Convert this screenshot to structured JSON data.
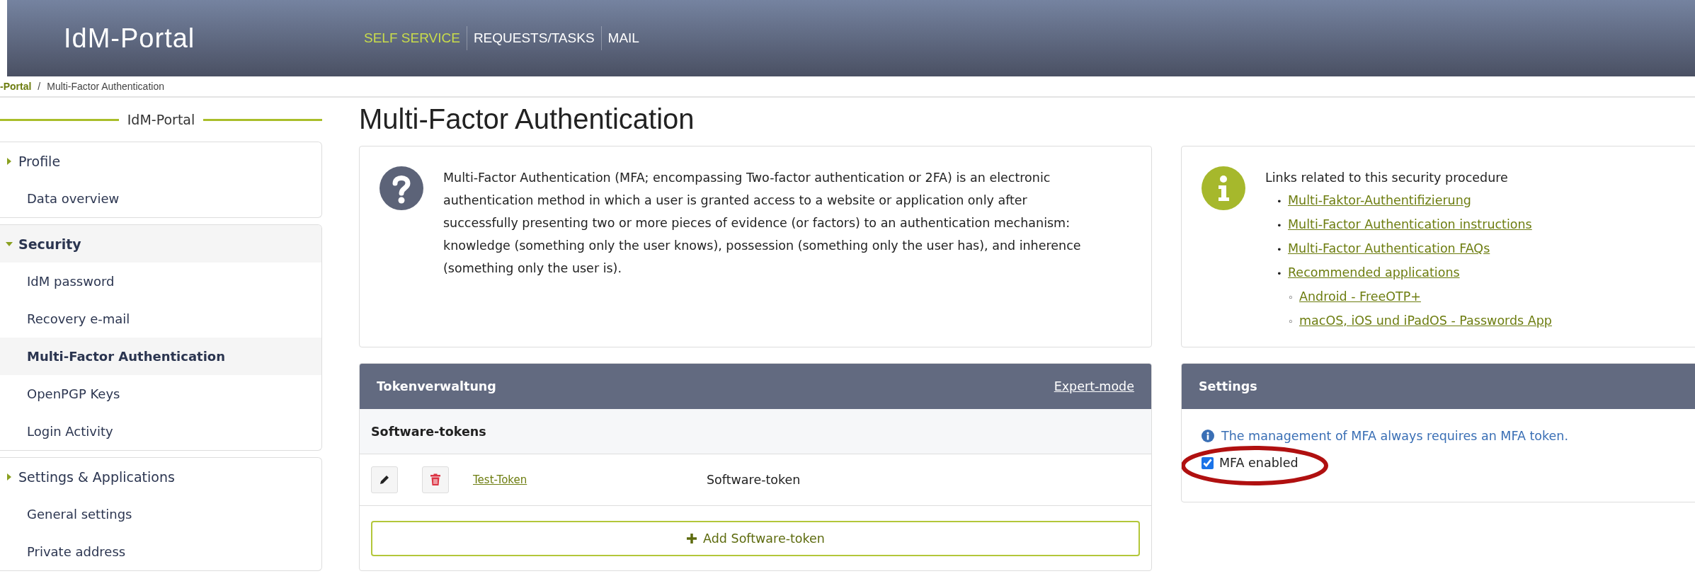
{
  "header": {
    "logo": "IdM-Portal",
    "nav": [
      {
        "label": "SELF SERVICE",
        "selected": true
      },
      {
        "label": "REQUESTS/TASKS",
        "selected": false
      },
      {
        "label": "MAIL",
        "selected": false
      }
    ]
  },
  "breadcrumb": {
    "items": [
      "-Portal",
      "Multi-Factor Authentication"
    ],
    "separator": "/"
  },
  "sidebar": {
    "title": "IdM-Portal",
    "groups": [
      {
        "label": "Profile",
        "expanded": false,
        "items": [
          {
            "label": "Data overview",
            "selected": false
          }
        ]
      },
      {
        "label": "Security",
        "expanded": true,
        "items": [
          {
            "label": "IdM password",
            "selected": false
          },
          {
            "label": "Recovery e-mail",
            "selected": false
          },
          {
            "label": "Multi-Factor Authentication",
            "selected": true
          },
          {
            "label": "OpenPGP Keys",
            "selected": false
          },
          {
            "label": "Login Activity",
            "selected": false
          }
        ]
      },
      {
        "label": "Settings & Applications",
        "expanded": false,
        "items": [
          {
            "label": "General settings",
            "selected": false
          },
          {
            "label": "Private address",
            "selected": false
          }
        ]
      }
    ]
  },
  "page_title": "Multi-Factor Authentication",
  "info_card": {
    "text": "Multi-Factor Authentication (MFA; encompassing Two-factor authentication or 2FA) is an electronic authentication method in which a user is granted access to a website or application only after successfully presenting two or more pieces of evidence (or factors) to an authentication mechanism: knowledge (something only the user knows), possession (something only the user has), and inherence (something only the user is)."
  },
  "links_card": {
    "heading": "Links related to this security procedure",
    "links": [
      {
        "marker": "•",
        "label": "Multi-Faktor-Authentifizierung"
      },
      {
        "marker": "•",
        "label": "Multi-Factor Authentication instructions"
      },
      {
        "marker": "•",
        "label": "Multi-Factor Authentication FAQs"
      },
      {
        "marker": "•",
        "label": "Recommended applications",
        "children": [
          {
            "marker": "◦",
            "label": "Android - FreeOTP+"
          },
          {
            "marker": "◦",
            "label": "macOS, iOS und iPadOS - Passwords App"
          }
        ]
      }
    ]
  },
  "token_panel": {
    "title": "Tokenverwaltung",
    "expert_mode": "Expert-mode",
    "section": "Software-tokens",
    "tokens": [
      {
        "name": "Test-Token",
        "type": "Software-token"
      }
    ],
    "add_button": "Add Software-token"
  },
  "settings_panel": {
    "title": "Settings",
    "note": "The management of MFA always requires an MFA token.",
    "checkboxes": [
      {
        "label": "MFA enabled",
        "checked": true,
        "highlighted": true
      }
    ]
  }
}
